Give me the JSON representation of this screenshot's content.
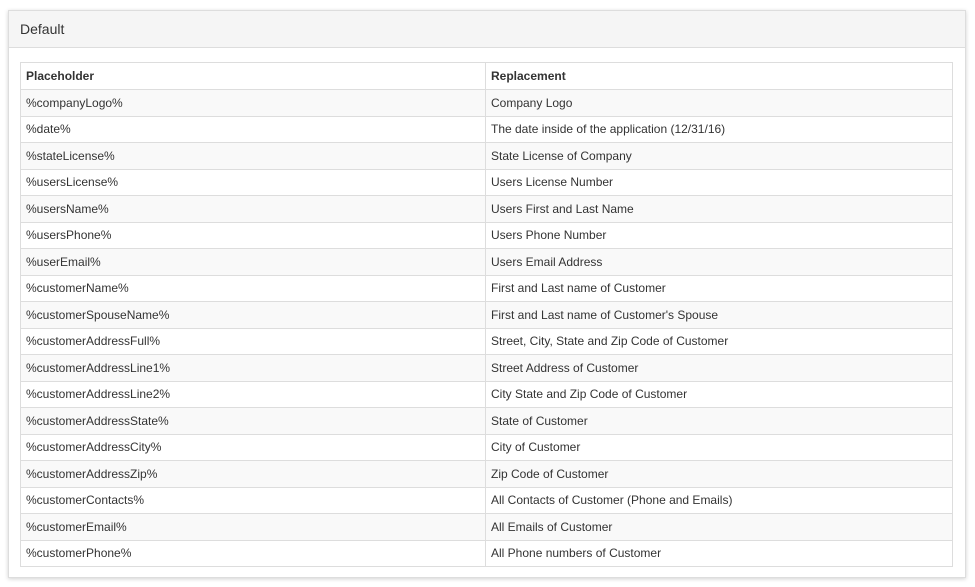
{
  "panel": {
    "title": "Default"
  },
  "table": {
    "columns": [
      "Placeholder",
      "Replacement"
    ],
    "rows": [
      {
        "placeholder": "%companyLogo%",
        "replacement": "Company Logo"
      },
      {
        "placeholder": "%date%",
        "replacement": "The date inside of the application (12/31/16)"
      },
      {
        "placeholder": "%stateLicense%",
        "replacement": "State License of Company"
      },
      {
        "placeholder": "%usersLicense%",
        "replacement": "Users License Number"
      },
      {
        "placeholder": "%usersName%",
        "replacement": "Users First and Last Name"
      },
      {
        "placeholder": "%usersPhone%",
        "replacement": "Users Phone Number"
      },
      {
        "placeholder": "%userEmail%",
        "replacement": "Users Email Address"
      },
      {
        "placeholder": "%customerName%",
        "replacement": "First and Last name of Customer"
      },
      {
        "placeholder": "%customerSpouseName%",
        "replacement": "First and Last name of Customer's Spouse"
      },
      {
        "placeholder": "%customerAddressFull%",
        "replacement": "Street, City, State and Zip Code of Customer"
      },
      {
        "placeholder": "%customerAddressLine1%",
        "replacement": "Street Address of Customer"
      },
      {
        "placeholder": "%customerAddressLine2%",
        "replacement": "City State and Zip Code of Customer"
      },
      {
        "placeholder": "%customerAddressState%",
        "replacement": "State of Customer"
      },
      {
        "placeholder": "%customerAddressCity%",
        "replacement": "City of Customer"
      },
      {
        "placeholder": "%customerAddressZip%",
        "replacement": "Zip Code of Customer"
      },
      {
        "placeholder": "%customerContacts%",
        "replacement": "All Contacts of Customer (Phone and Emails)"
      },
      {
        "placeholder": "%customerEmail%",
        "replacement": "All Emails of Customer"
      },
      {
        "placeholder": "%customerPhone%",
        "replacement": "All Phone numbers of Customer"
      }
    ]
  }
}
